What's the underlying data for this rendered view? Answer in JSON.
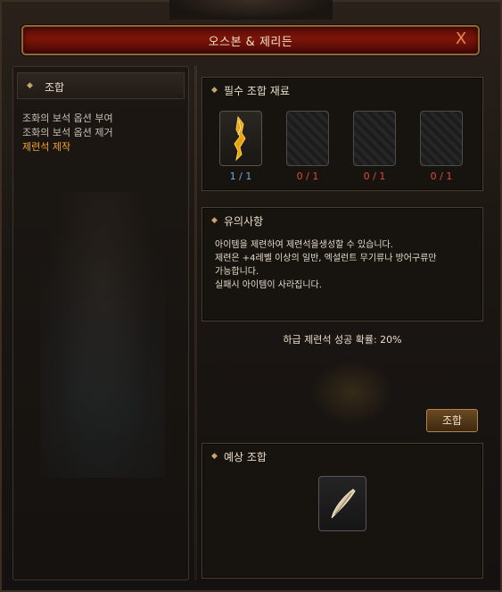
{
  "window": {
    "title": "오스본 & 제리든",
    "close_label": "X"
  },
  "sidebar": {
    "header": "조합",
    "items": [
      {
        "label": "조화의 보석 옵션 부여",
        "active": false
      },
      {
        "label": "조화의 보석 옵션 제거",
        "active": false
      },
      {
        "label": "제련석 제작",
        "active": true
      }
    ]
  },
  "materials": {
    "title": "필수 조합 재료",
    "slots": [
      {
        "icon": "golden-blade-icon",
        "count": "1 / 1",
        "status": "ok"
      },
      {
        "icon": "empty-slot",
        "count": "0 / 1",
        "status": "missing"
      },
      {
        "icon": "empty-slot",
        "count": "0 / 1",
        "status": "missing"
      },
      {
        "icon": "empty-slot",
        "count": "0 / 1",
        "status": "missing"
      }
    ]
  },
  "notice": {
    "title": "유의사항",
    "lines": [
      "아이템을 제련하여 제련석을생성할 수 있습니다.",
      "제련은 +4레벨 이상의 일반, 엑설런트 무기류나 방어구류만",
      "가능합니다.",
      "실패시 아이템이 사라집니다."
    ]
  },
  "success_rate": "하급 제련석 성공 확률: 20%",
  "combine_button": "조합",
  "expected": {
    "title": "예상 조합",
    "icon": "feather-quill-icon"
  },
  "colors": {
    "accent_active": "#f4a326",
    "count_ok": "#6ab0e8",
    "count_missing": "#e24a3a",
    "title_bar": "#7c1509"
  }
}
